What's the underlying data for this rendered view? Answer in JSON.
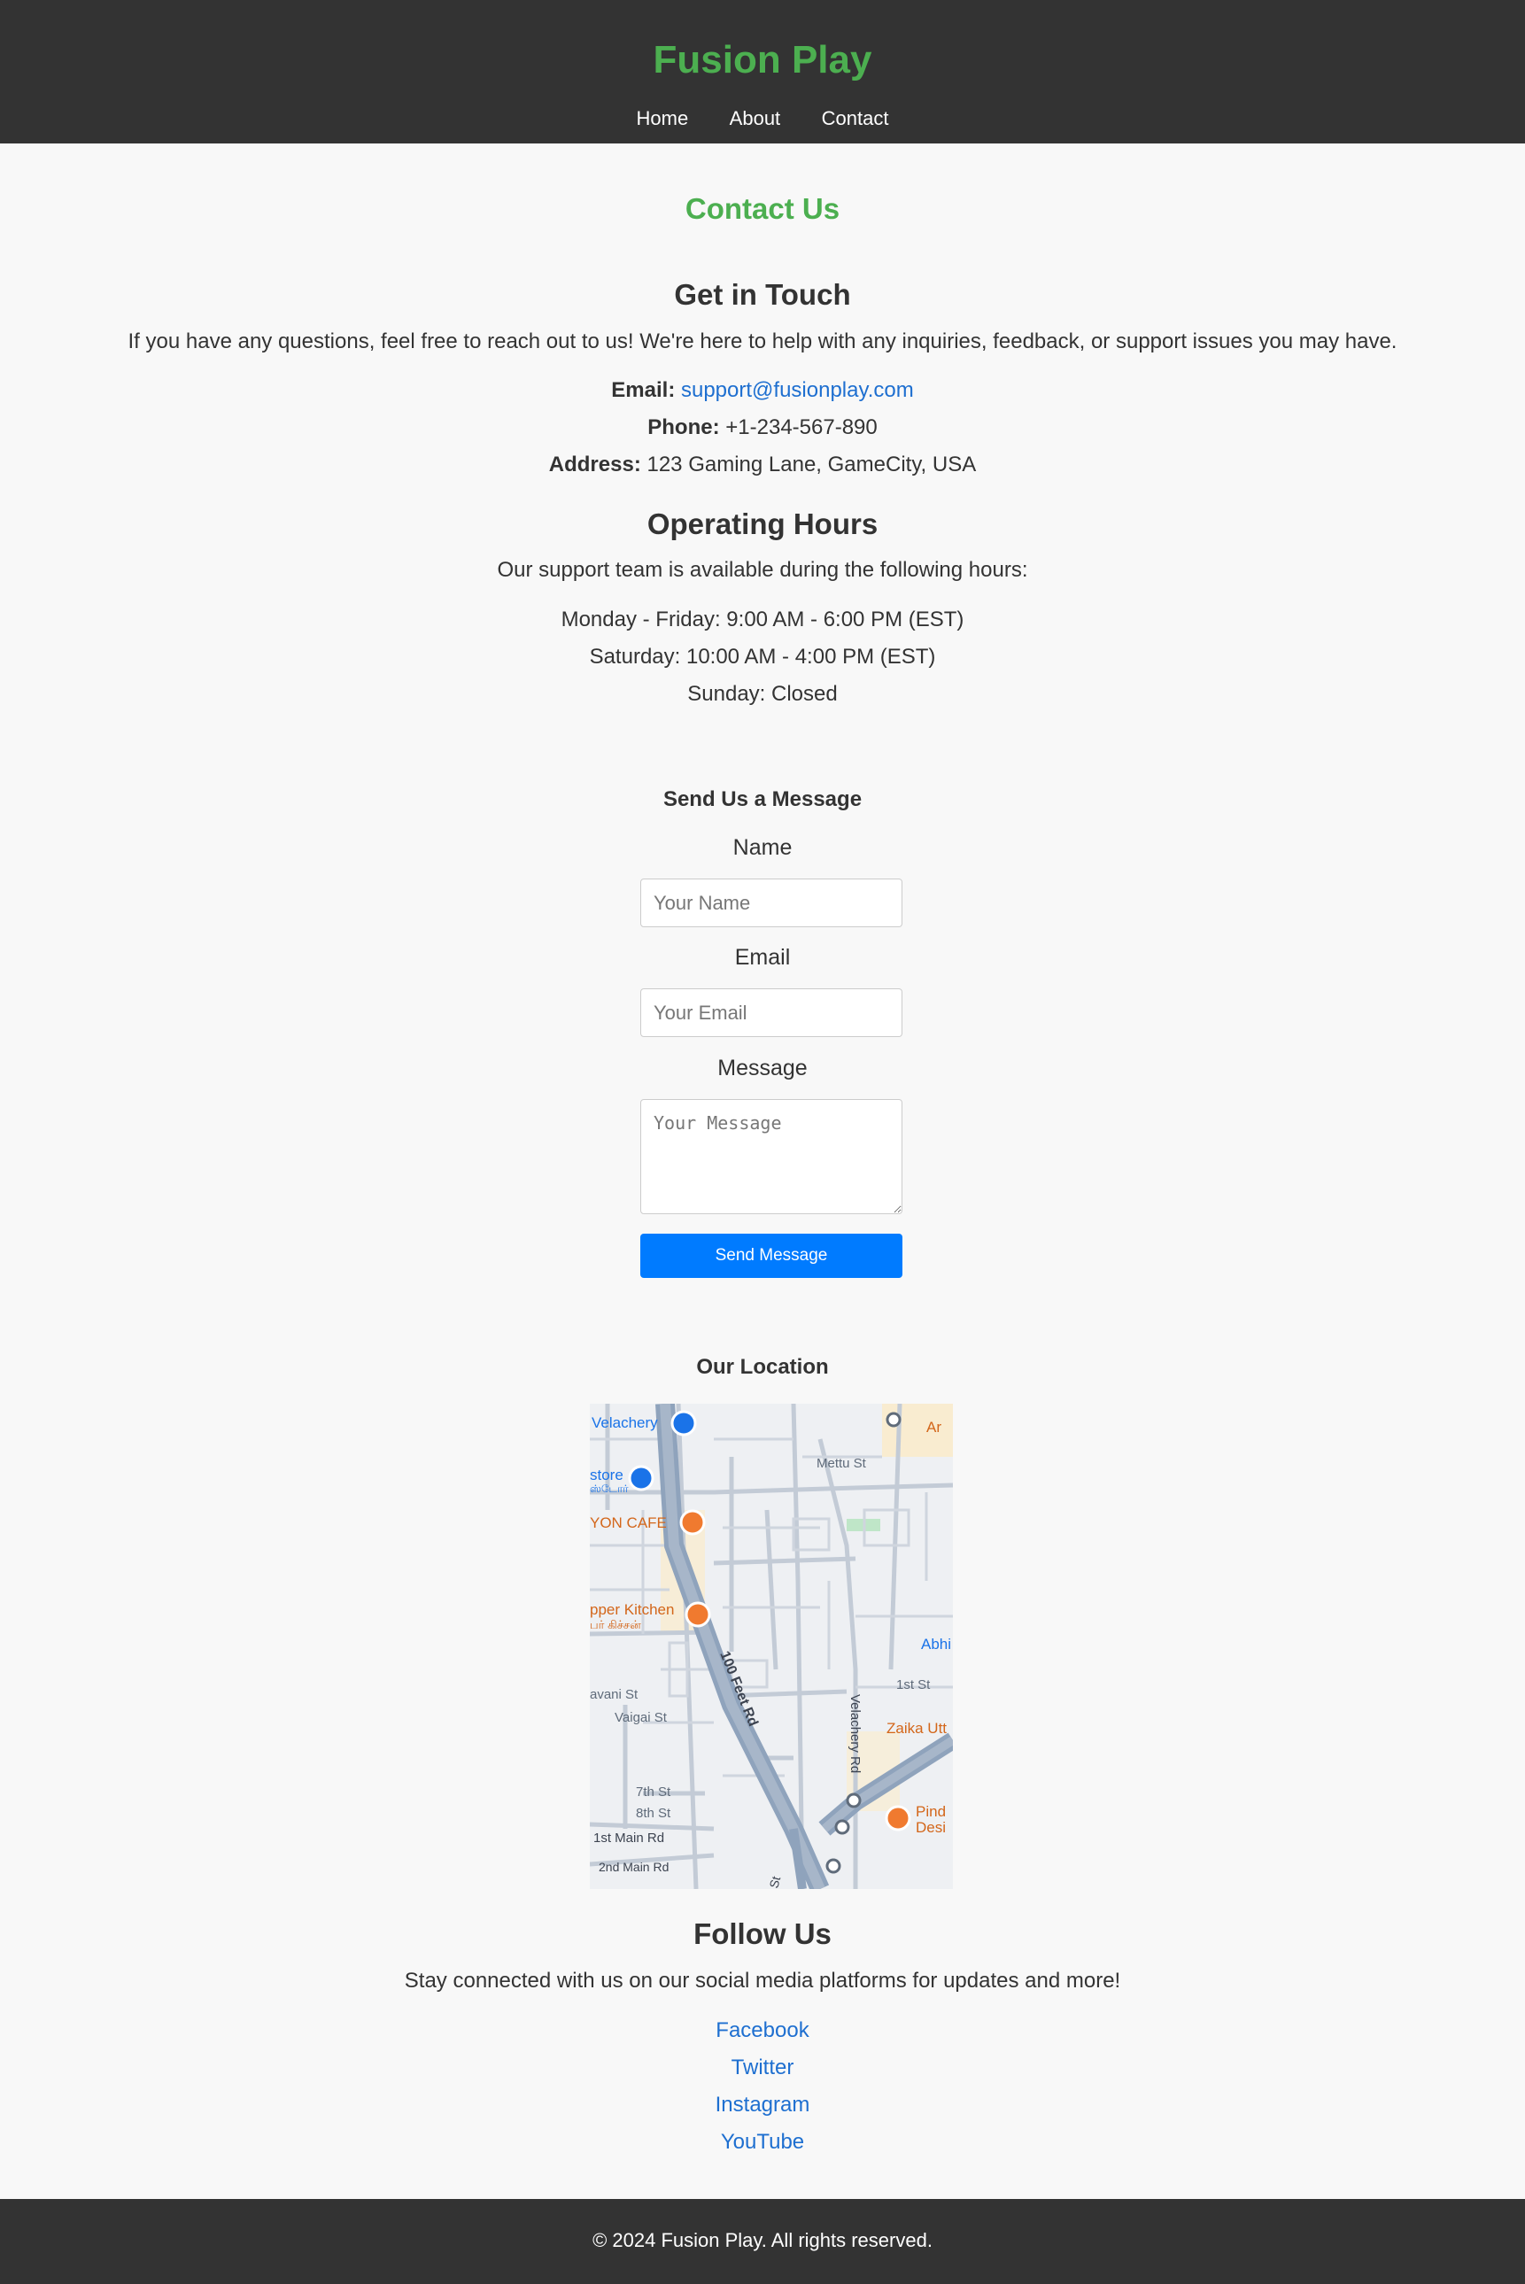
{
  "header": {
    "site_title": "Fusion Play",
    "nav": [
      "Home",
      "About",
      "Contact"
    ]
  },
  "page_title": "Contact Us",
  "get_in_touch": {
    "heading": "Get in Touch",
    "intro": "If you have any questions, feel free to reach out to us! We're here to help with any inquiries, feedback, or support issues you may have.",
    "email_label": "Email:",
    "email": "support@fusionplay.com",
    "phone_label": "Phone:",
    "phone": "+1-234-567-890",
    "address_label": "Address:",
    "address": "123 Gaming Lane, GameCity, USA"
  },
  "hours": {
    "heading": "Operating Hours",
    "intro": "Our support team is available during the following hours:",
    "weekday": "Monday - Friday: 9:00 AM - 6:00 PM (EST)",
    "saturday": "Saturday: 10:00 AM - 4:00 PM (EST)",
    "sunday": "Sunday: Closed"
  },
  "form": {
    "heading": "Send Us a Message",
    "name_label": "Name",
    "name_placeholder": "Your Name",
    "email_label": "Email",
    "email_placeholder": "Your Email",
    "message_label": "Message",
    "message_placeholder": "Your Message",
    "submit_label": "Send Message"
  },
  "location": {
    "heading": "Our Location",
    "map_labels": {
      "velachery": "Velachery",
      "store": "store",
      "store_ta": "ஸ்டோர்",
      "cafe": "YON CAFE",
      "kitchen": "pper Kitchen",
      "kitchen_ta": "பர் கிச்சன்",
      "mettu": "Mettu St",
      "feet_rd": "100 Feet Rd",
      "velachery_rd": "Velachery Rd",
      "abhi": "Abhi",
      "first_st": "1st St",
      "zaika": "Zaika Utt",
      "bhavani": "avani St",
      "vaigai": "Vaigai St",
      "seventh": "7th St",
      "eighth": "8th St",
      "first_main": "1st Main Rd",
      "second_main": "2nd Main Rd",
      "pind": "Pind",
      "desi": "Desi",
      "ar": "Ar",
      "st": "St"
    }
  },
  "follow": {
    "heading": "Follow Us",
    "intro": "Stay connected with us on our social media platforms for updates and more!",
    "links": [
      "Facebook",
      "Twitter",
      "Instagram",
      "YouTube"
    ]
  },
  "footer": {
    "copyright": "© 2024 Fusion Play. All rights reserved."
  },
  "colors": {
    "brand_green": "#4caf50",
    "header_bg": "#333333",
    "link_blue": "#1e6fd0",
    "button_blue": "#007bff",
    "page_bg": "#f8f8f8"
  }
}
